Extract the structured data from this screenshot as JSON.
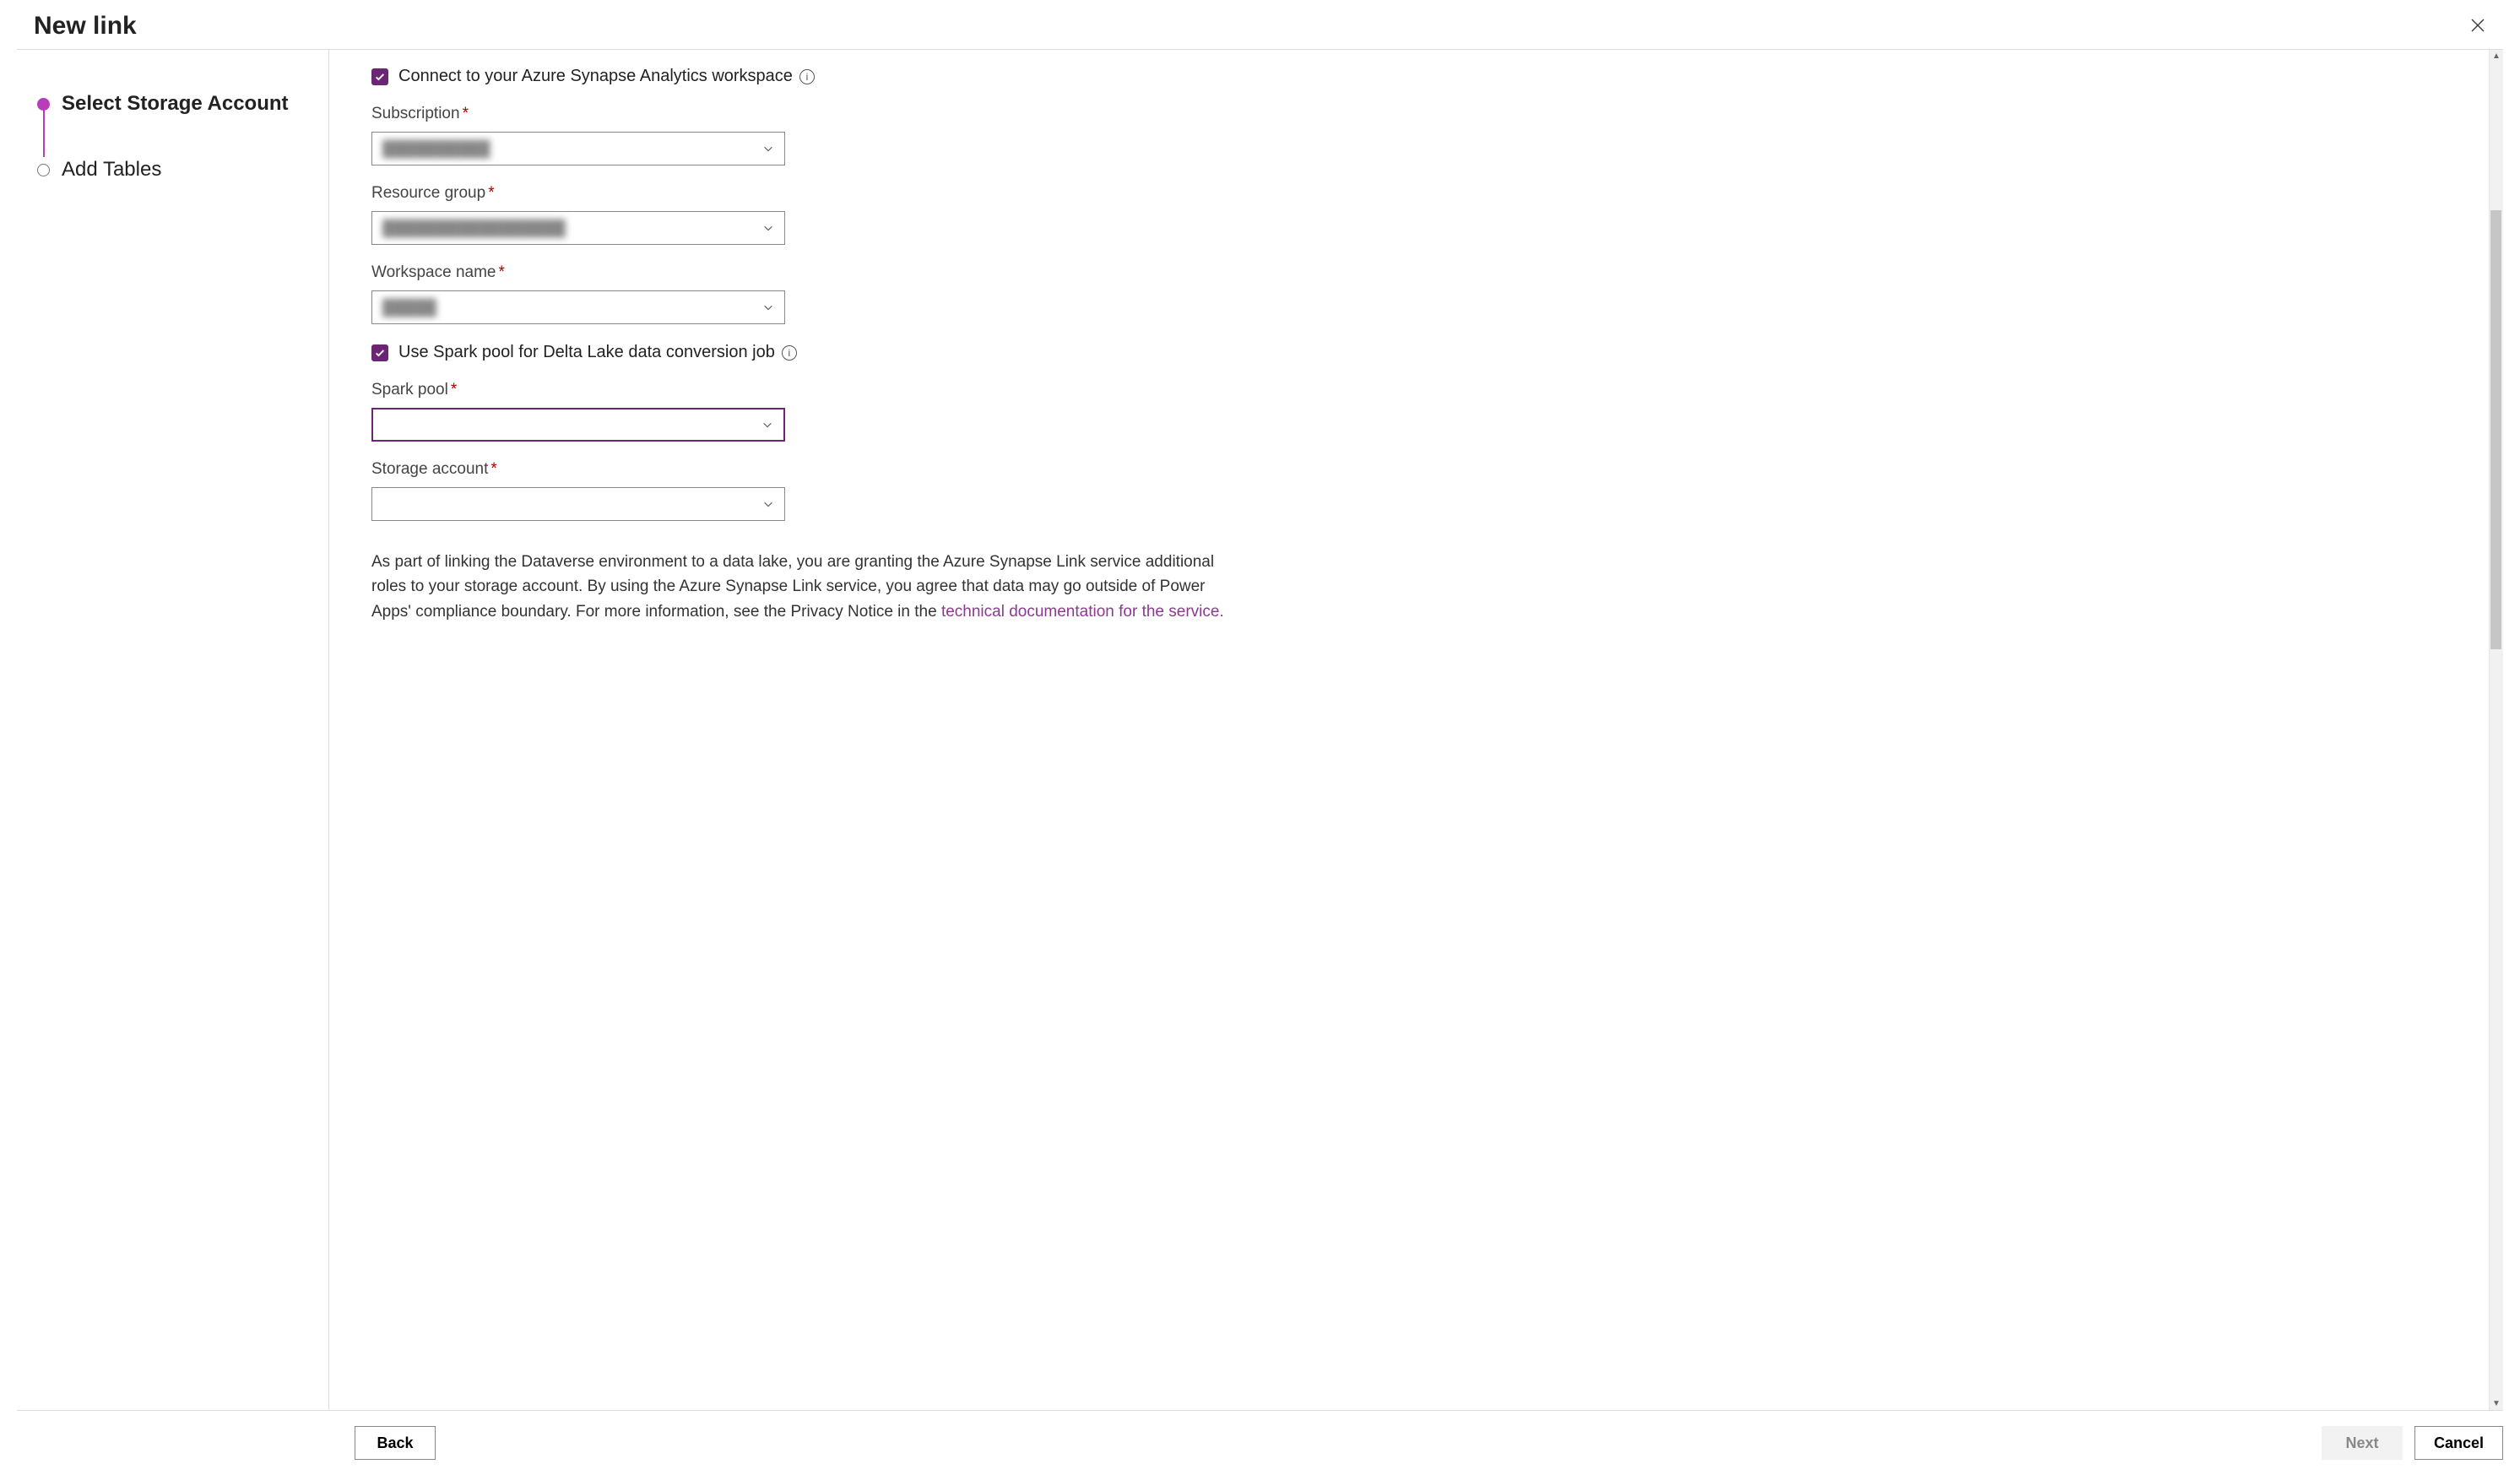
{
  "dialog": {
    "title": "New link"
  },
  "steps": {
    "step1": "Select Storage Account",
    "step2": "Add Tables"
  },
  "form": {
    "connectCheckbox": {
      "label": "Connect to your Azure Synapse Analytics workspace",
      "checked": true
    },
    "subscription": {
      "label": "Subscription",
      "value": "██████████"
    },
    "resourceGroup": {
      "label": "Resource group",
      "value": "█████████████████"
    },
    "workspaceName": {
      "label": "Workspace name",
      "value": "█████"
    },
    "sparkCheckbox": {
      "label": "Use Spark pool for Delta Lake data conversion job",
      "checked": true
    },
    "sparkPool": {
      "label": "Spark pool",
      "value": ""
    },
    "storageAccount": {
      "label": "Storage account",
      "value": ""
    },
    "legal": {
      "prefix": "As part of linking the Dataverse environment to a data lake, you are granting the Azure Synapse Link service additional roles to your storage account. By using the Azure Synapse Link service, you agree that data may go outside of Power Apps' compliance boundary. For more information, see the Privacy Notice in the ",
      "linkText": "technical documentation for the service."
    }
  },
  "footer": {
    "back": "Back",
    "next": "Next",
    "cancel": "Cancel"
  },
  "icons": {
    "info": "i"
  }
}
